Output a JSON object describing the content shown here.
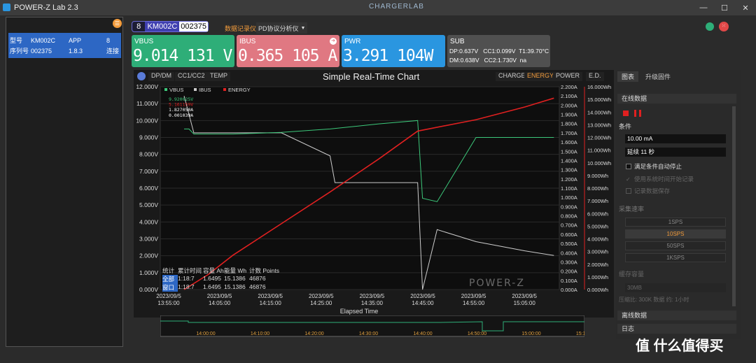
{
  "app": {
    "title": "POWER-Z Lab 2.3",
    "logo": "CHARGERLAB"
  },
  "left": {
    "rows": [
      {
        "k": "型号",
        "v": "KM002C",
        "k2": "APP",
        "v2": "8"
      },
      {
        "k": "序列号",
        "v": "002375",
        "k2": "1.8.3",
        "v2": "连接"
      }
    ]
  },
  "header": {
    "num": "8",
    "model": "KM002C",
    "serial": "002375",
    "tab1": "数据记录仪",
    "tab2": "PD协议分析仪"
  },
  "meters": {
    "vbus": {
      "label": "VBUS",
      "value": "9.014 131 V",
      "color": "#2eae78"
    },
    "ibus": {
      "label": "IBUS",
      "value": "0.365 105 A",
      "color": "#e07882"
    },
    "pwr": {
      "label": "PWR",
      "value": "3.291 104W",
      "color": "#2a96e0"
    },
    "sub": {
      "label": "SUB",
      "line1": "DP:0.637V   CC1:0.099V  T1:39.70°C",
      "line2": "DM:0.638V   CC2:1.730V  na"
    }
  },
  "chart_tabs": {
    "left": [
      "DP/DM",
      "CC1/CC2",
      "TEMP"
    ],
    "right": [
      "CHARGE",
      "ENERGY",
      "POWER",
      "E.D."
    ],
    "active_right": "ENERGY"
  },
  "chart_data": {
    "type": "line",
    "title": "Simple Real-Time Chart",
    "xlabel": "Elapsed Time",
    "x_ticks": [
      "2023/09/5\n13:55:00",
      "2023/09/5\n14:05:00",
      "2023/09/5\n14:15:00",
      "2023/09/5\n14:25:00",
      "2023/09/5\n14:35:00",
      "2023/09/5\n14:45:00",
      "2023/09/5\n14:55:00",
      "2023/09/5\n15:05:00"
    ],
    "y_left_ticks": [
      "12.000V",
      "11.000V",
      "10.000V",
      "9.000V",
      "8.000V",
      "7.000V",
      "6.000V",
      "5.000V",
      "4.000V",
      "3.000V",
      "2.000V",
      "1.000V",
      "0.000V"
    ],
    "y_right1_ticks": [
      "2.200A",
      "2.100A",
      "2.000A",
      "1.900A",
      "1.800A",
      "1.700A",
      "1.600A",
      "1.500A",
      "1.400A",
      "1.300A",
      "1.200A",
      "1.100A",
      "1.000A",
      "0.900A",
      "0.800A",
      "0.700A",
      "0.600A",
      "0.500A",
      "0.400A",
      "0.300A",
      "0.200A",
      "0.100A",
      "0.000A"
    ],
    "y_right2_ticks": [
      "16.000Wh",
      "15.000Wh",
      "14.000Wh",
      "13.000Wh",
      "12.000Wh",
      "11.000Wh",
      "10.000Wh",
      "9.000Wh",
      "8.000Wh",
      "7.000Wh",
      "6.000Wh",
      "5.000Wh",
      "4.000Wh",
      "3.000Wh",
      "2.000Wh",
      "1.000Wh",
      "0.000Wh"
    ],
    "legend": [
      {
        "name": "VBUS",
        "color": "#3cc87a"
      },
      {
        "name": "IBUS",
        "color": "#cccccc"
      },
      {
        "name": "ENERGY",
        "color": "#e02020"
      }
    ],
    "cursor_readouts": [
      {
        "text": "9.920025V",
        "color": "#3cc87a"
      },
      {
        "text": "5.161159V",
        "color": "#e02020"
      },
      {
        "text": "1.827050A",
        "color": "#ffffff"
      },
      {
        "text": "0.001039A",
        "color": "#ffffff"
      }
    ],
    "series": [
      {
        "name": "ENERGY",
        "x_min": [
          0,
          5,
          10,
          20,
          30,
          40,
          48,
          60,
          70,
          76
        ],
        "wh": [
          0.0,
          1.2,
          2.7,
          5.2,
          7.7,
          10.3,
          12.5,
          13.4,
          14.4,
          15.1
        ]
      },
      {
        "name": "VBUS",
        "x_min": [
          0,
          1,
          2,
          10,
          20,
          30,
          40,
          48,
          49,
          52,
          60,
          70,
          76
        ],
        "v": [
          9.5,
          9.5,
          9.2,
          9.2,
          9.3,
          9.5,
          9.8,
          10.0,
          5.4,
          5.2,
          9.0,
          9.0,
          9.0
        ]
      },
      {
        "name": "IBUS",
        "x_min": [
          0,
          2,
          10,
          20,
          30,
          31,
          40,
          48,
          49,
          52,
          60,
          70,
          76
        ],
        "a": [
          2.1,
          1.7,
          1.7,
          1.7,
          1.45,
          1.16,
          1.16,
          1.16,
          0.0,
          0.65,
          0.52,
          0.42,
          0.37
        ]
      }
    ]
  },
  "stats": {
    "headers": [
      "统计",
      "累计时间",
      "容量 Ah",
      "能量 Wh",
      "计数 Points"
    ],
    "rows": [
      [
        "全部",
        "1:18:7",
        "1.6495",
        "15.1386",
        "46876"
      ],
      [
        "窗口",
        "1:18:7",
        "1.6495",
        "15.1386",
        "46876"
      ]
    ]
  },
  "overview": {
    "ticks": [
      "14:00:00",
      "14:10:00",
      "14:20:00",
      "14:30:00",
      "14:40:00",
      "14:50:00",
      "15:00:00",
      "15:10:00"
    ]
  },
  "watermark": "POWER-Z",
  "right": {
    "tabs": [
      "图表",
      "升级固件"
    ],
    "online": "在线数据",
    "condition": "条件",
    "threshold": "10.00 mA",
    "delay": "延续 11 秒",
    "checks": [
      "满足条件自动停止",
      "使用系统时间开始记录",
      "记录数据保存"
    ],
    "rate_label": "采集速率",
    "sps": [
      "1SPS",
      "10SPS",
      "50SPS",
      "1KSPS"
    ],
    "active_sps": "10SPS",
    "cache_label": "缓存容量",
    "cache": "30MB",
    "cache_note": "压缩比: 300K 数据 约: 1小时",
    "offline": "离线数据",
    "log": "日志"
  },
  "brand_watermark": "值 什么值得买"
}
